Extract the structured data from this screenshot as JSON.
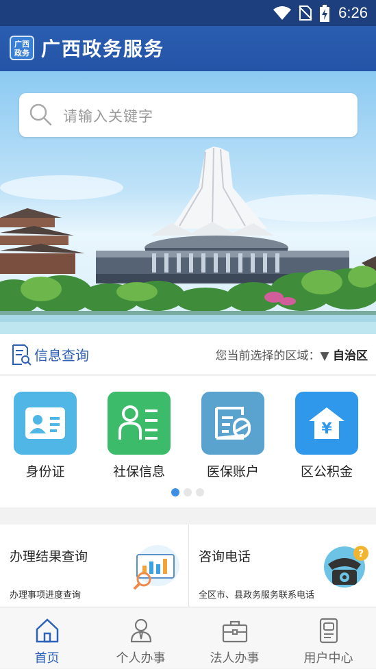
{
  "status_bar": {
    "time": "6:26"
  },
  "app_bar": {
    "logo_text": "广西\n政务",
    "title": "广西政务服务"
  },
  "search": {
    "placeholder": "请输入关键字"
  },
  "info_bar": {
    "title": "信息查询",
    "region_prefix": "您当前选择的区域：",
    "region_value": "自治区"
  },
  "quick_icons": [
    {
      "label": "身份证",
      "color": "#4fb6e6",
      "icon": "id-card-icon"
    },
    {
      "label": "社保信息",
      "color": "#3cbb6a",
      "icon": "social-security-icon"
    },
    {
      "label": "医保账户",
      "color": "#5aa3cf",
      "icon": "medical-insurance-icon"
    },
    {
      "label": "区公积金",
      "color": "#2f98ea",
      "icon": "housing-fund-icon"
    }
  ],
  "pager": {
    "count": 3,
    "active": 0
  },
  "cards": [
    {
      "title": "办理结果查询",
      "subtitle": "办理事项进度查询",
      "icon": "result-query-icon"
    },
    {
      "title": "咨询电话",
      "subtitle": "全区市、县政务服务联系电话",
      "icon": "consult-phone-icon"
    }
  ],
  "tabs": [
    {
      "label": "首页",
      "icon": "home-icon",
      "active": true
    },
    {
      "label": "个人办事",
      "icon": "person-icon",
      "active": false
    },
    {
      "label": "法人办事",
      "icon": "briefcase-icon",
      "active": false
    },
    {
      "label": "用户中心",
      "icon": "user-center-icon",
      "active": false
    }
  ]
}
